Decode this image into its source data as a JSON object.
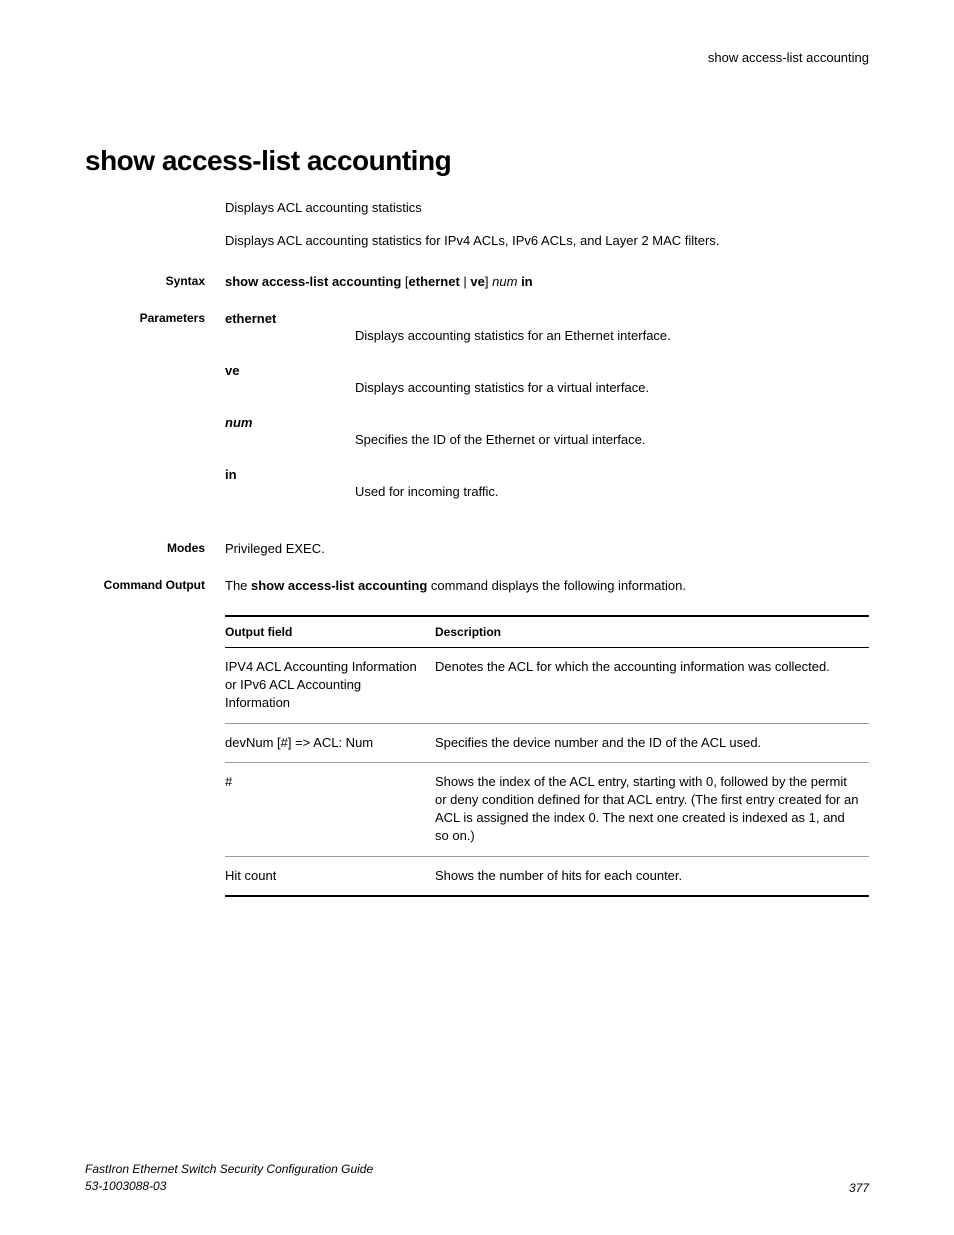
{
  "header": {
    "running_title": "show access-list accounting"
  },
  "title": "show access-list accounting",
  "summary": "Displays ACL accounting statistics",
  "description": "Displays ACL accounting statistics for IPv4 ACLs, IPv6 ACLs, and Layer 2 MAC filters.",
  "sections": {
    "syntax": {
      "label": "Syntax",
      "prefix": "show access-list accounting ",
      "bracket_open": "[",
      "opt1": "ethernet",
      "pipe": " | ",
      "opt2": "ve",
      "bracket_close": "]",
      "space": " ",
      "num": "num",
      "space2": " ",
      "in": "in"
    },
    "parameters": {
      "label": "Parameters",
      "items": [
        {
          "name": "ethernet",
          "italic": false,
          "desc": "Displays accounting statistics for an Ethernet interface."
        },
        {
          "name": "ve",
          "italic": false,
          "desc": "Displays accounting statistics for a virtual interface."
        },
        {
          "name": "num",
          "italic": true,
          "desc": "Specifies the ID of the Ethernet or virtual interface."
        },
        {
          "name": "in",
          "italic": false,
          "desc": "Used for incoming traffic."
        }
      ]
    },
    "modes": {
      "label": "Modes",
      "value": "Privileged EXEC."
    },
    "command_output": {
      "label": "Command Output",
      "pre": "The ",
      "cmd": "show access-list accounting",
      "post": " command displays the following information."
    }
  },
  "output_table": {
    "headers": {
      "field": "Output field",
      "desc": "Description"
    },
    "rows": [
      {
        "field": "IPV4 ACL Accounting Information or IPv6 ACL Accounting Information",
        "desc": "Denotes the ACL for which the accounting information was collected."
      },
      {
        "field": "devNum [#] => ACL: Num",
        "desc": "Specifies the device number and the ID of the ACL used."
      },
      {
        "field": "#",
        "desc": "Shows the index of the ACL entry, starting with 0, followed by the permit or deny condition defined for that ACL entry. (The first entry created for an ACL is assigned the index 0. The next one created is indexed as 1, and so on.)"
      },
      {
        "field": "Hit count",
        "desc": "Shows the number of hits for each counter."
      }
    ]
  },
  "footer": {
    "guide": "FastIron Ethernet Switch Security Configuration Guide",
    "docnum": "53-1003088-03",
    "page": "377"
  }
}
